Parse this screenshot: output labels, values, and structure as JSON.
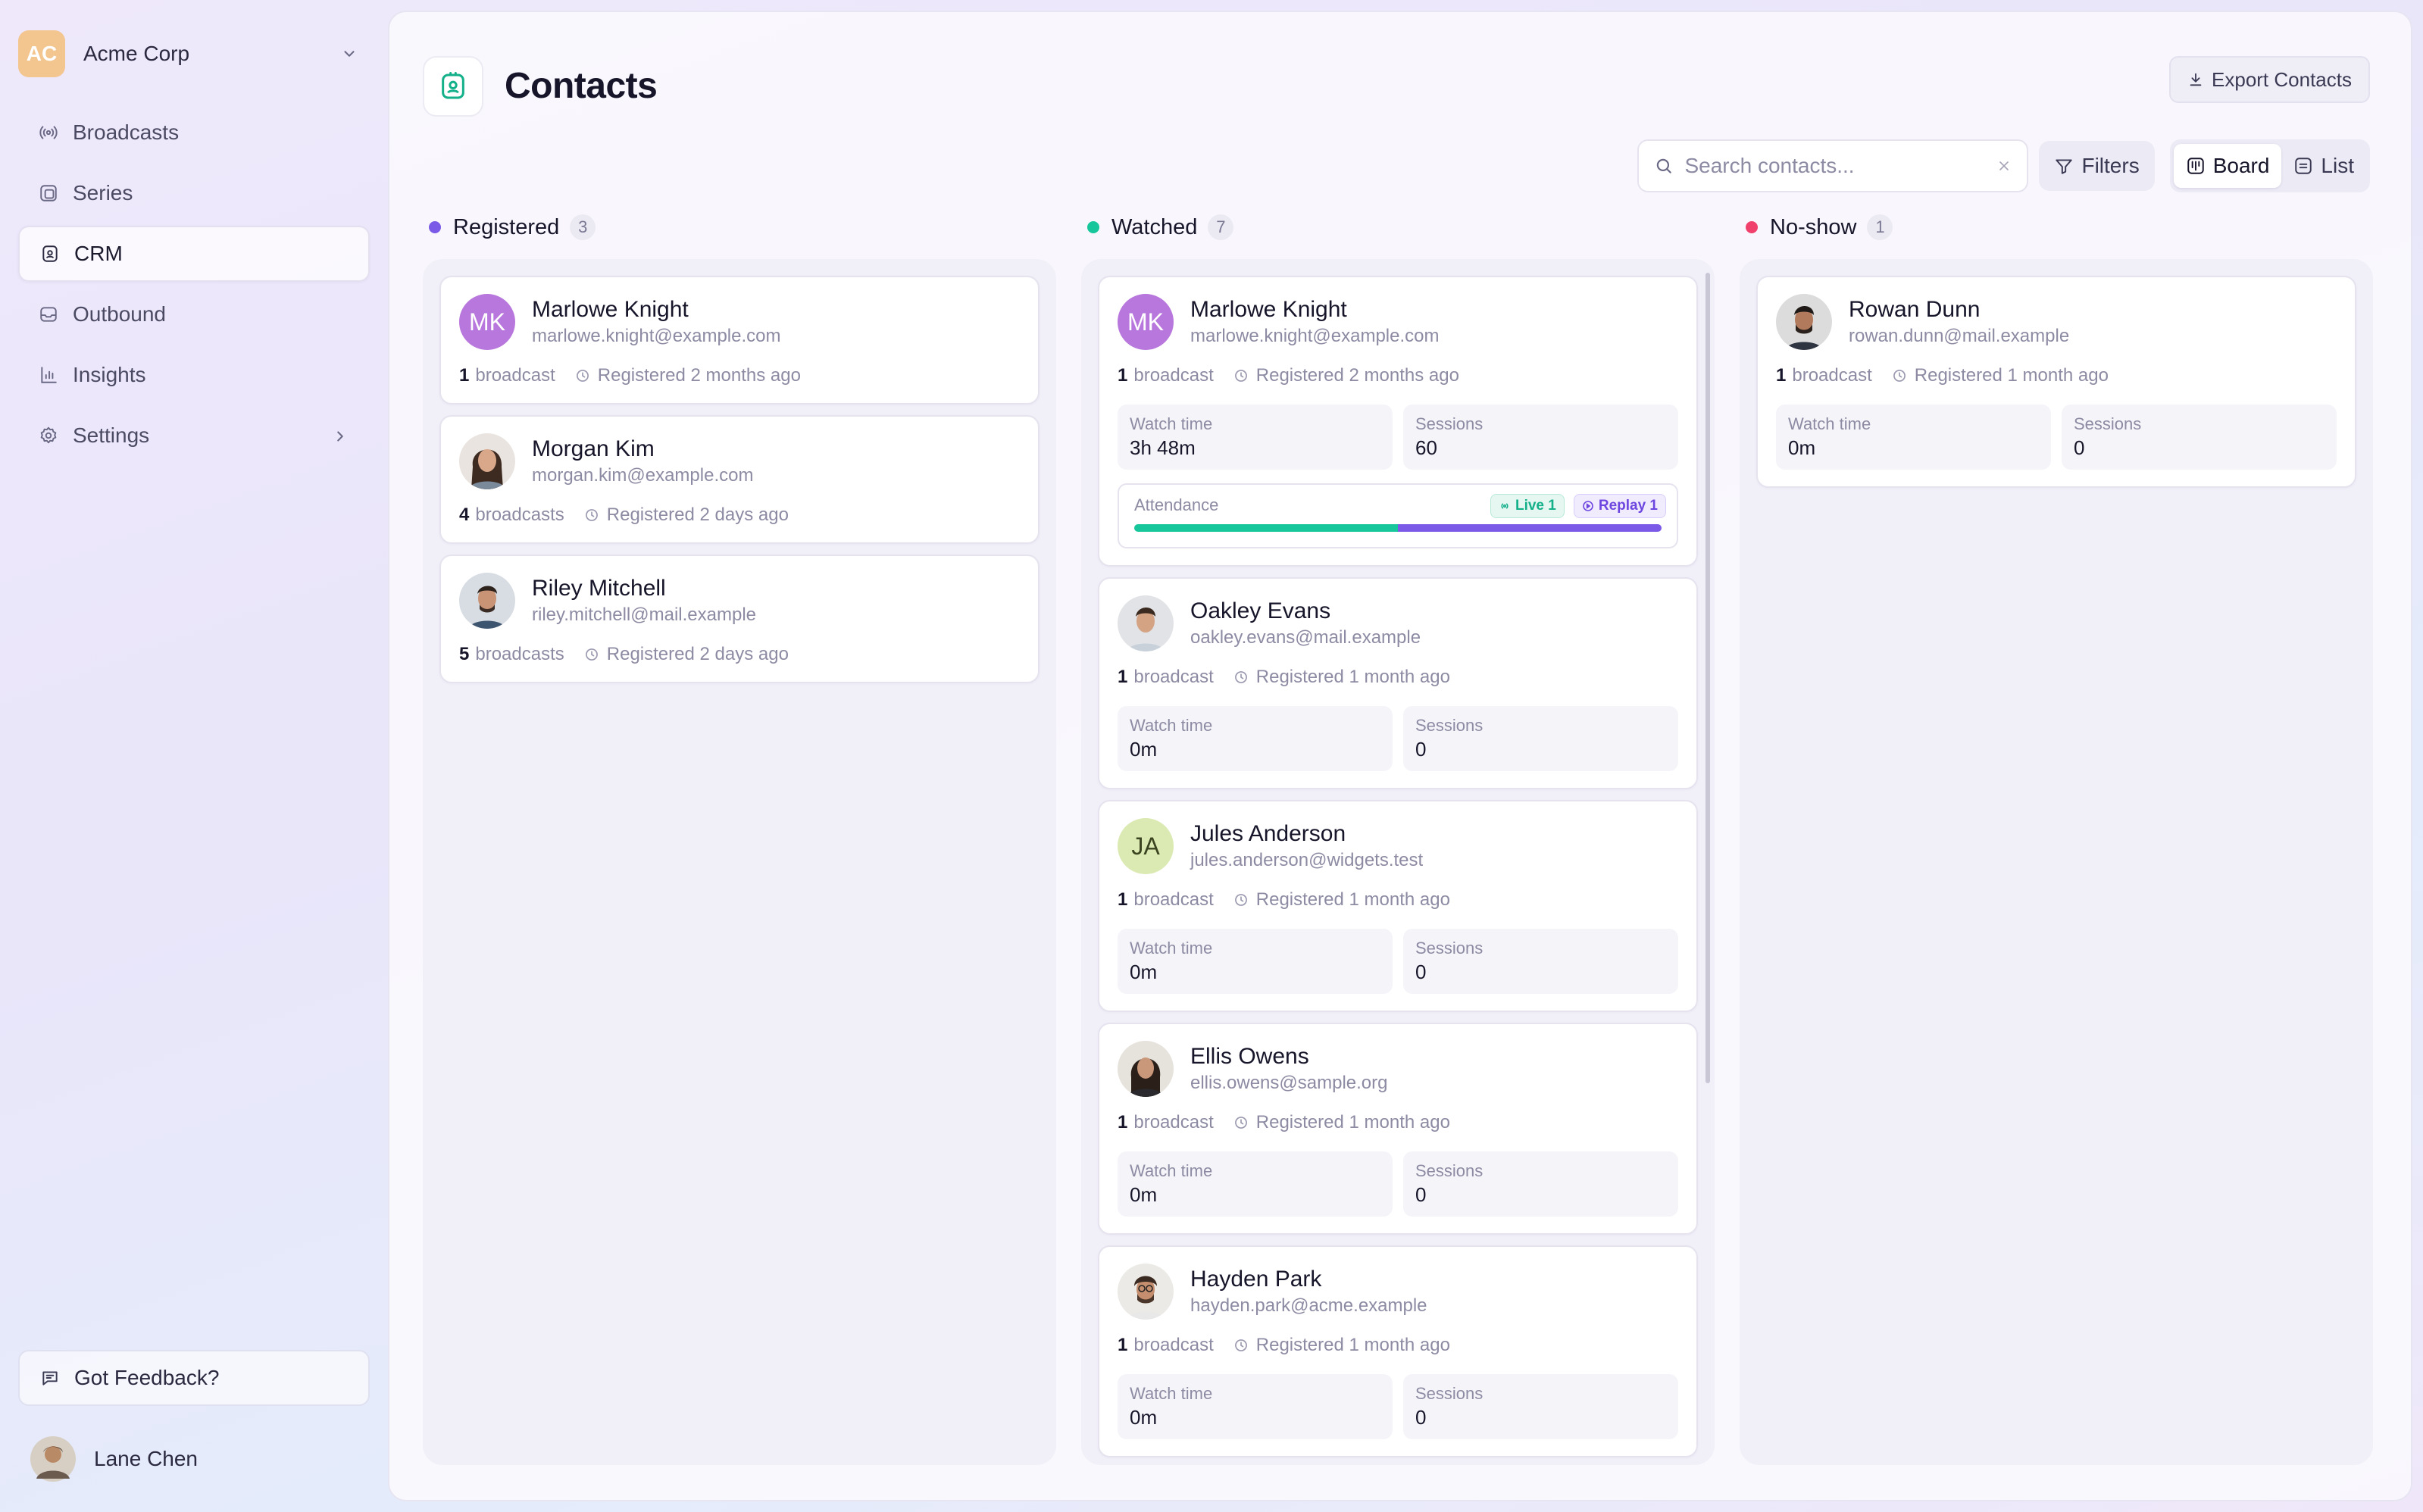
{
  "org": {
    "initials": "AC",
    "name": "Acme Corp"
  },
  "nav": {
    "items": [
      {
        "label": "Broadcasts",
        "icon": "broadcast-icon"
      },
      {
        "label": "Series",
        "icon": "series-icon"
      },
      {
        "label": "CRM",
        "icon": "crm-icon",
        "active": true
      },
      {
        "label": "Outbound",
        "icon": "outbound-icon"
      },
      {
        "label": "Insights",
        "icon": "insights-icon"
      },
      {
        "label": "Settings",
        "icon": "gear-icon"
      }
    ]
  },
  "feedback": {
    "label": "Got Feedback?"
  },
  "user": {
    "name": "Lane Chen"
  },
  "page": {
    "title": "Contacts",
    "export_label": "Export Contacts"
  },
  "toolbar": {
    "search_placeholder": "Search contacts...",
    "filters_label": "Filters",
    "board_label": "Board",
    "list_label": "List",
    "active_view": "Board"
  },
  "colors": {
    "registered": "#7b5ae8",
    "watched": "#17c79b",
    "noshow": "#f0416d",
    "accent": "#6d46e0"
  },
  "columns": [
    {
      "title": "Registered",
      "count": "3",
      "cards": [
        {
          "name": "Marlowe Knight",
          "email": "marlowe.knight@example.com",
          "initials": "MK",
          "broadcasts": "1",
          "broadcast_word": "broadcast",
          "registered": "Registered 2 months ago"
        },
        {
          "name": "Morgan Kim",
          "email": "morgan.kim@example.com",
          "broadcasts": "4",
          "broadcast_word": "broadcasts",
          "registered": "Registered 2 days ago"
        },
        {
          "name": "Riley Mitchell",
          "email": "riley.mitchell@mail.example",
          "broadcasts": "5",
          "broadcast_word": "broadcasts",
          "registered": "Registered 2 days ago"
        }
      ]
    },
    {
      "title": "Watched",
      "count": "7",
      "cards": [
        {
          "name": "Marlowe Knight",
          "email": "marlowe.knight@example.com",
          "initials": "MK",
          "broadcasts": "1",
          "broadcast_word": "broadcast",
          "registered": "Registered 2 months ago",
          "watch_time_label": "Watch time",
          "watch_time": "3h 48m",
          "sessions_label": "Sessions",
          "sessions": "60",
          "attendance": {
            "label": "Attendance",
            "live_label": "Live 1",
            "replay_label": "Replay 1",
            "live_fraction": 0.5,
            "replay_fraction": 0.5
          }
        },
        {
          "name": "Oakley Evans",
          "email": "oakley.evans@mail.example",
          "broadcasts": "1",
          "broadcast_word": "broadcast",
          "registered": "Registered 1 month ago",
          "watch_time_label": "Watch time",
          "watch_time": "0m",
          "sessions_label": "Sessions",
          "sessions": "0"
        },
        {
          "name": "Jules Anderson",
          "email": "jules.anderson@widgets.test",
          "initials": "JA",
          "broadcasts": "1",
          "broadcast_word": "broadcast",
          "registered": "Registered 1 month ago",
          "watch_time_label": "Watch time",
          "watch_time": "0m",
          "sessions_label": "Sessions",
          "sessions": "0"
        },
        {
          "name": "Ellis Owens",
          "email": "ellis.owens@sample.org",
          "broadcasts": "1",
          "broadcast_word": "broadcast",
          "registered": "Registered 1 month ago",
          "watch_time_label": "Watch time",
          "watch_time": "0m",
          "sessions_label": "Sessions",
          "sessions": "0"
        },
        {
          "name": "Hayden Park",
          "email": "hayden.park@acme.example",
          "broadcasts": "1",
          "broadcast_word": "broadcast",
          "registered": "Registered 1 month ago",
          "watch_time_label": "Watch time",
          "watch_time": "0m",
          "sessions_label": "Sessions",
          "sessions": "0"
        }
      ]
    },
    {
      "title": "No-show",
      "count": "1",
      "cards": [
        {
          "name": "Rowan Dunn",
          "email": "rowan.dunn@mail.example",
          "broadcasts": "1",
          "broadcast_word": "broadcast",
          "registered": "Registered 1 month ago",
          "watch_time_label": "Watch time",
          "watch_time": "0m",
          "sessions_label": "Sessions",
          "sessions": "0"
        }
      ]
    }
  ]
}
